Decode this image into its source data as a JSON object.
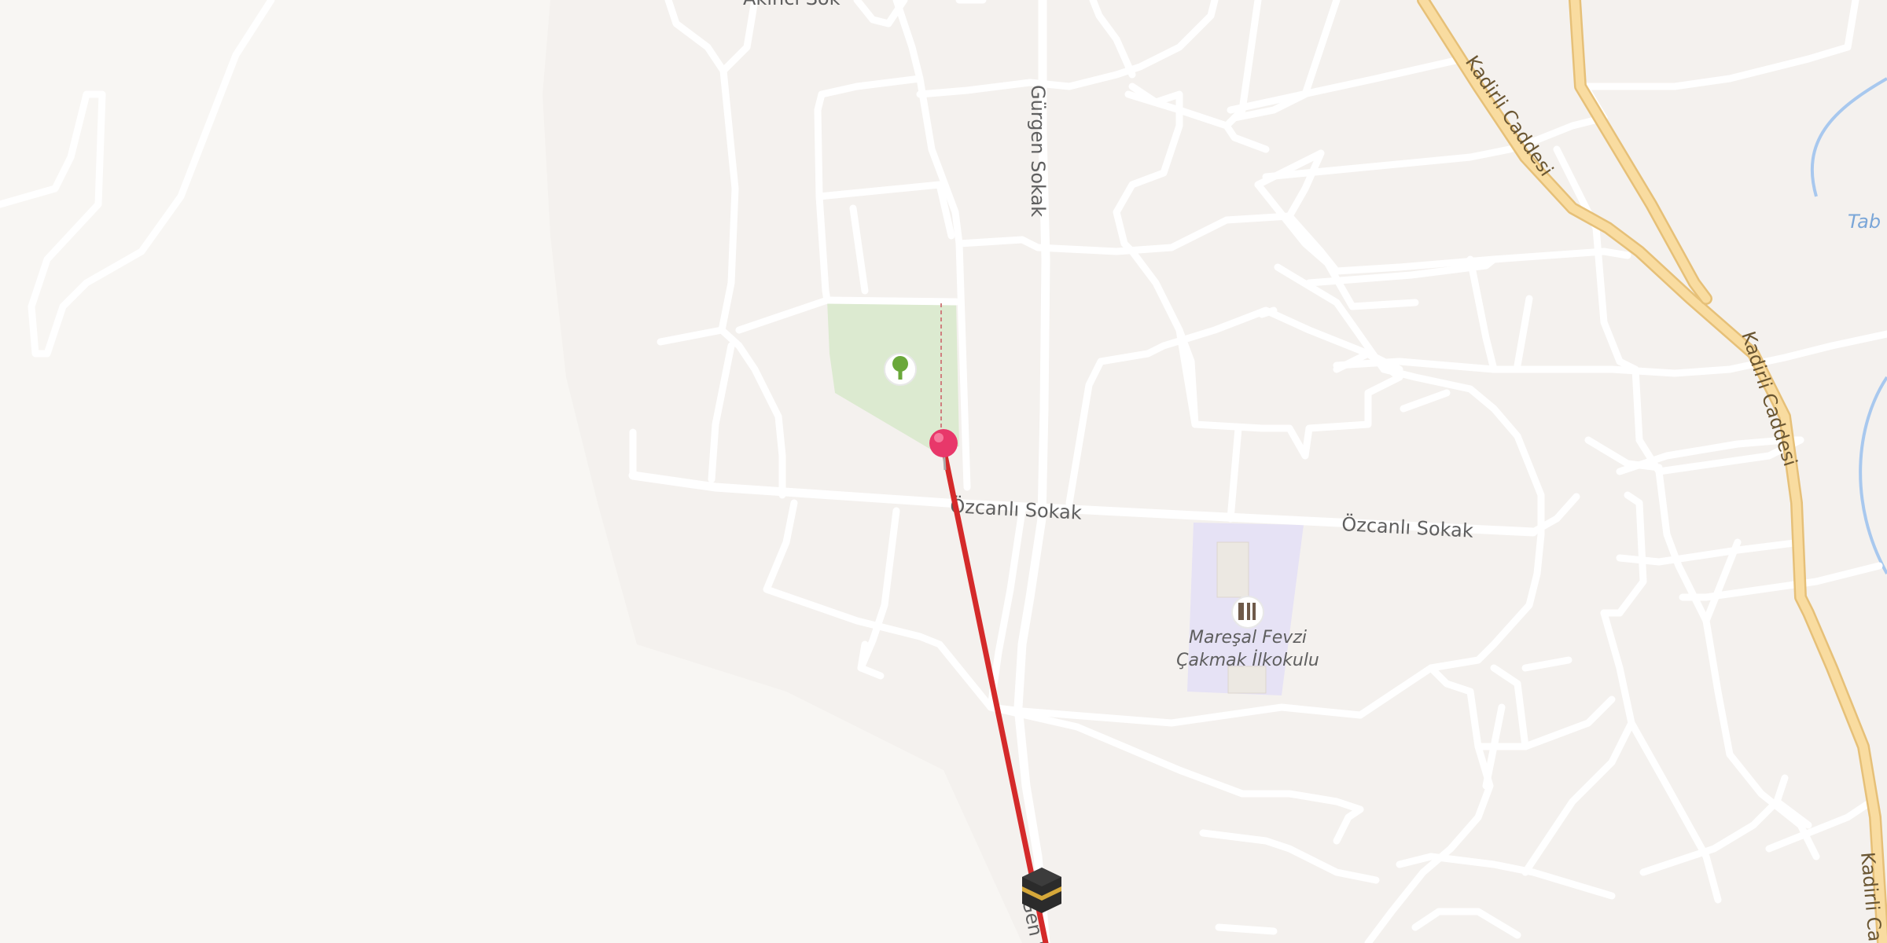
{
  "map": {
    "road_labels": {
      "gurgen": "Gürgen Sokak",
      "gurgen_bottom": "Gen S",
      "ozcanli_left": "Özcanlı Sokak",
      "ozcanli_right": "Özcanlı Sokak",
      "kadirli_1": "Kadirli Caddesi",
      "kadirli_2": "Kadirli Caddesi",
      "kadirli_3": "Kadirli Ca",
      "top_cut": "Akıncı Sok"
    },
    "water_label": "Tab",
    "poi": {
      "school_line1": "Mareşal Fevzi",
      "school_line2": "Çakmak İlkokulu"
    },
    "icons": {
      "park": "tree-icon",
      "school": "school-icon",
      "destination": "kaaba-icon",
      "location": "location-pin-icon"
    },
    "colors": {
      "background": "#f4f1ee",
      "road": "#ffffff",
      "major_road": "#f6d69a",
      "park": "#dcead0",
      "school": "#e6e2f5",
      "water": "#a8c8ee",
      "route": "#d42a2a",
      "pin": "#e8386a"
    }
  }
}
